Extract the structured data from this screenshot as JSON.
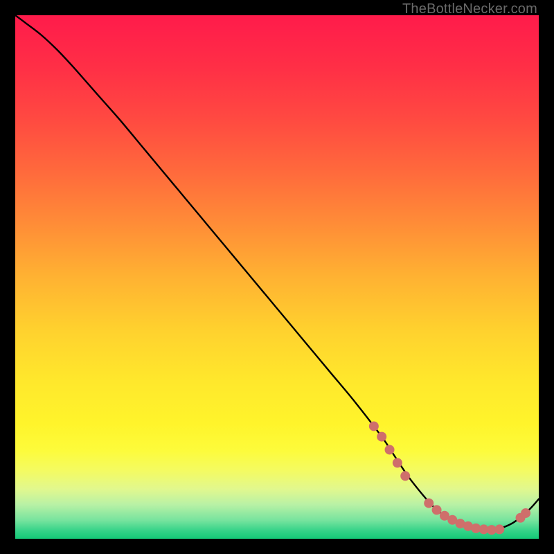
{
  "attribution": "TheBottleNecker.com",
  "colors": {
    "curve": "#000000",
    "marker": "#cf6f6b",
    "frame": "#000000"
  },
  "chart_data": {
    "type": "line",
    "title": "",
    "xlabel": "",
    "ylabel": "",
    "xlim": [
      0,
      100
    ],
    "ylim": [
      0,
      100
    ],
    "grid": false,
    "legend": false,
    "series": [
      {
        "name": "curve",
        "x": [
          0,
          2,
          5,
          8,
          11,
          14,
          17,
          20,
          25,
          30,
          35,
          40,
          45,
          50,
          55,
          60,
          65,
          70,
          72,
          75,
          78,
          80,
          82,
          84,
          86,
          88,
          90,
          92,
          95,
          98,
          100
        ],
        "y": [
          100,
          98.5,
          96.2,
          93.4,
          90.2,
          86.8,
          83.4,
          80,
          74,
          68,
          62,
          56,
          50,
          44,
          38,
          32,
          26,
          19.5,
          16.5,
          12,
          8.2,
          6,
          4.4,
          3.2,
          2.4,
          1.8,
          1.6,
          1.8,
          3,
          5.4,
          7.6
        ]
      }
    ],
    "markers": [
      {
        "x": 68.5,
        "y": 21.5
      },
      {
        "x": 70.0,
        "y": 19.5
      },
      {
        "x": 71.5,
        "y": 17.0
      },
      {
        "x": 73.0,
        "y": 14.5
      },
      {
        "x": 74.5,
        "y": 12.0
      },
      {
        "x": 79.0,
        "y": 6.8
      },
      {
        "x": 80.5,
        "y": 5.5
      },
      {
        "x": 82.0,
        "y": 4.4
      },
      {
        "x": 83.5,
        "y": 3.6
      },
      {
        "x": 85.0,
        "y": 2.9
      },
      {
        "x": 86.5,
        "y": 2.4
      },
      {
        "x": 88.0,
        "y": 2.0
      },
      {
        "x": 89.5,
        "y": 1.8
      },
      {
        "x": 91.0,
        "y": 1.7
      },
      {
        "x": 92.5,
        "y": 1.8
      },
      {
        "x": 96.5,
        "y": 4.0
      },
      {
        "x": 97.5,
        "y": 4.9
      }
    ],
    "gradient_stops": [
      {
        "offset": 0.0,
        "color": "#ff1b4b"
      },
      {
        "offset": 0.1,
        "color": "#ff2f46"
      },
      {
        "offset": 0.2,
        "color": "#ff4a41"
      },
      {
        "offset": 0.3,
        "color": "#ff6a3c"
      },
      {
        "offset": 0.4,
        "color": "#ff8d37"
      },
      {
        "offset": 0.5,
        "color": "#ffb232"
      },
      {
        "offset": 0.6,
        "color": "#ffd12e"
      },
      {
        "offset": 0.7,
        "color": "#ffe82c"
      },
      {
        "offset": 0.78,
        "color": "#fff42b"
      },
      {
        "offset": 0.83,
        "color": "#fdfb3a"
      },
      {
        "offset": 0.87,
        "color": "#f4fb62"
      },
      {
        "offset": 0.905,
        "color": "#e1f88e"
      },
      {
        "offset": 0.935,
        "color": "#b8f1a5"
      },
      {
        "offset": 0.965,
        "color": "#76e39e"
      },
      {
        "offset": 0.985,
        "color": "#34d388"
      },
      {
        "offset": 1.0,
        "color": "#14c977"
      }
    ]
  }
}
